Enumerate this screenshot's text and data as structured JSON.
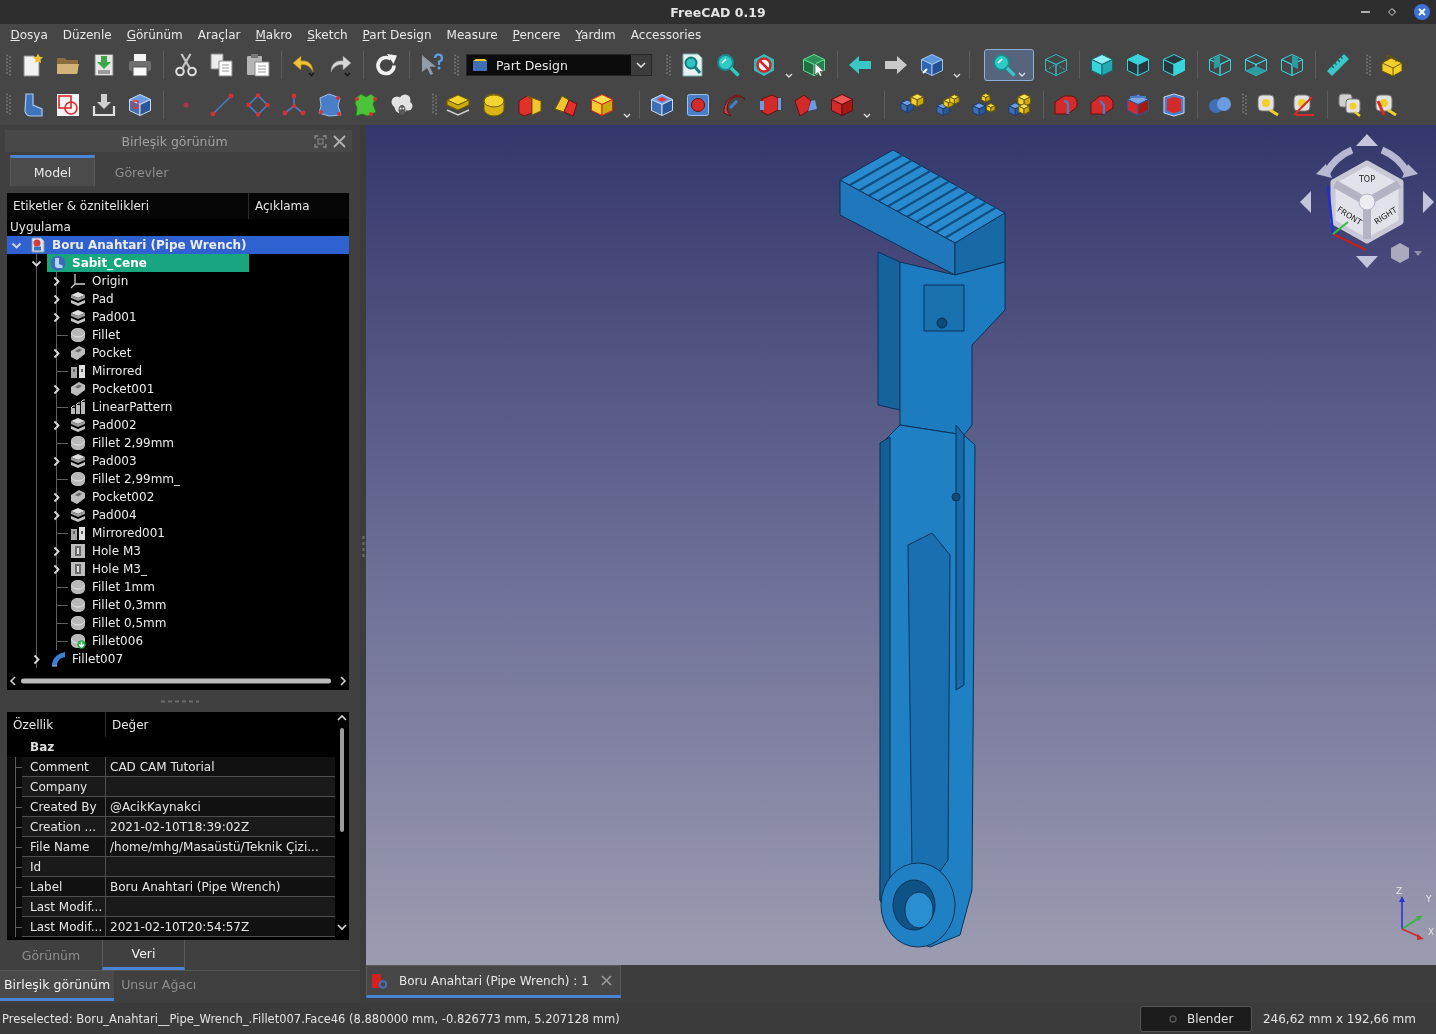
{
  "window": {
    "title": "FreeCAD 0.19"
  },
  "menu": [
    {
      "label": "Dosya",
      "mnemonic": true
    },
    {
      "label": "Düzenle",
      "mnemonic": false
    },
    {
      "label": "Görünüm",
      "mnemonic": true
    },
    {
      "label": "Araçlar",
      "mnemonic": false
    },
    {
      "label": "Makro",
      "mnemonic": true
    },
    {
      "label": "Sketch",
      "mnemonic": true
    },
    {
      "label": "Part Design",
      "mnemonic": true
    },
    {
      "label": "Measure",
      "mnemonic": false
    },
    {
      "label": "Pencere",
      "mnemonic": true
    },
    {
      "label": "Yardım",
      "mnemonic": true
    },
    {
      "label": "Accessories",
      "mnemonic": false
    }
  ],
  "toolbar": {
    "workbench": {
      "label": "Part Design"
    },
    "zoom_tool": {
      "checked": true
    }
  },
  "combo_view": {
    "title": "Birleşik görünüm",
    "tabs": [
      {
        "label": "Model",
        "selected": true
      },
      {
        "label": "Görevler",
        "selected": false
      }
    ],
    "tree": {
      "columns": [
        "Etiketler & öznitelikleri",
        "Açıklama"
      ],
      "group": "Uygulama",
      "items": [
        {
          "label": "Boru Anahtari (Pipe Wrench)",
          "kind": "document",
          "expandable": true,
          "expanded": true,
          "selected": true,
          "active": false,
          "tip": false,
          "children": [
            {
              "label": "Sabit_Cene",
              "kind": "body",
              "expandable": true,
              "expanded": true,
              "selected": false,
              "active": true,
              "tip": false,
              "children": [
                {
                  "label": "Origin",
                  "kind": "origin",
                  "expandable": true,
                  "expanded": false,
                  "selected": false,
                  "active": false,
                  "tip": false
                },
                {
                  "label": "Pad",
                  "kind": "pad",
                  "expandable": true,
                  "expanded": false,
                  "selected": false,
                  "active": false,
                  "tip": false
                },
                {
                  "label": "Pad001",
                  "kind": "pad",
                  "expandable": true,
                  "expanded": false,
                  "selected": false,
                  "active": false,
                  "tip": false
                },
                {
                  "label": "Fillet",
                  "kind": "fillet",
                  "expandable": false,
                  "selected": false,
                  "active": false,
                  "tip": false
                },
                {
                  "label": "Pocket",
                  "kind": "pocket",
                  "expandable": true,
                  "expanded": false,
                  "selected": false,
                  "active": false,
                  "tip": false
                },
                {
                  "label": "Mirrored",
                  "kind": "mirrored",
                  "expandable": false,
                  "selected": false,
                  "active": false,
                  "tip": false
                },
                {
                  "label": "Pocket001",
                  "kind": "pocket",
                  "expandable": true,
                  "expanded": false,
                  "selected": false,
                  "active": false,
                  "tip": false
                },
                {
                  "label": "LinearPattern",
                  "kind": "pattern",
                  "expandable": false,
                  "selected": false,
                  "active": false,
                  "tip": false
                },
                {
                  "label": "Pad002",
                  "kind": "pad",
                  "expandable": true,
                  "expanded": false,
                  "selected": false,
                  "active": false,
                  "tip": false
                },
                {
                  "label": "Fillet 2,99mm",
                  "kind": "fillet",
                  "expandable": false,
                  "selected": false,
                  "active": false,
                  "tip": false
                },
                {
                  "label": "Pad003",
                  "kind": "pad",
                  "expandable": true,
                  "expanded": false,
                  "selected": false,
                  "active": false,
                  "tip": false
                },
                {
                  "label": "Fillet 2,99mm_",
                  "kind": "fillet",
                  "expandable": false,
                  "selected": false,
                  "active": false,
                  "tip": false
                },
                {
                  "label": "Pocket002",
                  "kind": "pocket",
                  "expandable": true,
                  "expanded": false,
                  "selected": false,
                  "active": false,
                  "tip": false
                },
                {
                  "label": "Pad004",
                  "kind": "pad",
                  "expandable": true,
                  "expanded": false,
                  "selected": false,
                  "active": false,
                  "tip": false
                },
                {
                  "label": "Mirrored001",
                  "kind": "mirrored",
                  "expandable": false,
                  "selected": false,
                  "active": false,
                  "tip": false
                },
                {
                  "label": "Hole M3",
                  "kind": "hole",
                  "expandable": true,
                  "expanded": false,
                  "selected": false,
                  "active": false,
                  "tip": false
                },
                {
                  "label": "Hole M3_",
                  "kind": "hole",
                  "expandable": true,
                  "expanded": false,
                  "selected": false,
                  "active": false,
                  "tip": false
                },
                {
                  "label": "Fillet 1mm",
                  "kind": "fillet",
                  "expandable": false,
                  "selected": false,
                  "active": false,
                  "tip": false
                },
                {
                  "label": "Fillet 0,3mm",
                  "kind": "fillet",
                  "expandable": false,
                  "selected": false,
                  "active": false,
                  "tip": false
                },
                {
                  "label": "Fillet 0,5mm",
                  "kind": "fillet",
                  "expandable": false,
                  "selected": false,
                  "active": false,
                  "tip": false
                },
                {
                  "label": "Fillet006",
                  "kind": "fillet",
                  "expandable": false,
                  "selected": false,
                  "active": false,
                  "tip": true
                }
              ]
            },
            {
              "label": "Fillet007",
              "kind": "solid",
              "expandable": true,
              "expanded": false,
              "selected": false,
              "active": false,
              "tip": false
            }
          ]
        }
      ]
    },
    "properties": {
      "columns": [
        "Özellik",
        "Değer"
      ],
      "group": "Baz",
      "rows": [
        {
          "name": "Comment",
          "value": "CAD CAM Tutorial"
        },
        {
          "name": "Company"
        },
        {
          "name": "Created By",
          "value": "@AcikKaynakci"
        },
        {
          "name": "Creation ...",
          "value": "2021-02-10T18:39:02Z"
        },
        {
          "name": "File Name",
          "value": "/home/mhg/Masaüstü/Teknik Çizi..."
        },
        {
          "name": "Id"
        },
        {
          "name": "Label",
          "value": "Boru Anahtari (Pipe Wrench)"
        },
        {
          "name": "Last Modif..."
        },
        {
          "name": "Last Modif...",
          "value": "2021-02-10T20:54:57Z"
        }
      ]
    },
    "property_tabs": [
      {
        "label": "Görünüm",
        "selected": false
      },
      {
        "label": "Veri",
        "selected": true
      }
    ]
  },
  "dock_tabs": [
    {
      "label": "Birleşik görünüm",
      "selected": true
    },
    {
      "label": "Unsur Ağacı",
      "selected": false
    }
  ],
  "viewport": {
    "navigation_cube": {
      "faces": [
        "TOP",
        "FRONT",
        "RIGHT"
      ]
    },
    "axis_labels": [
      "Z",
      "Y",
      "X"
    ]
  },
  "document_tabs": [
    {
      "label": "Boru Anahtari (Pipe Wrench) : 1",
      "selected": true
    }
  ],
  "status_bar": {
    "message": "Preselected: Boru_Anahtari__Pipe_Wrench_.Fillet007.Face46 (8.880000 mm, -0.826773 mm, 5.207128 mm)",
    "navigation_style": "Blender",
    "dimensions": "246,62 mm x 192,66 mm"
  }
}
